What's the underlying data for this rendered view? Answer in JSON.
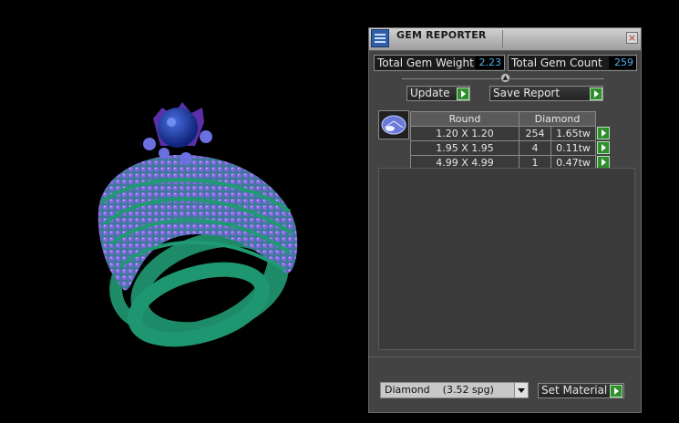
{
  "window": {
    "title": "GEM REPORTER",
    "close_glyph": "×"
  },
  "stats": {
    "weight_label": "Total Gem Weight",
    "weight_value": "2.23",
    "count_label": "Total Gem Count",
    "count_value": "259"
  },
  "toolbar": {
    "update_label": "Update",
    "save_label": "Save Report"
  },
  "table": {
    "headers": [
      "Round",
      "Diamond"
    ],
    "rows": [
      {
        "size": "1.20 X 1.20",
        "count": "254",
        "weight": "1.65tw"
      },
      {
        "size": "1.95 X 1.95",
        "count": "4",
        "weight": "0.11tw"
      },
      {
        "size": "4.99 X 4.99",
        "count": "1",
        "weight": "0.47tw"
      }
    ]
  },
  "material": {
    "selected": "Diamond    (3.52 spg)",
    "set_label": "Set Material"
  },
  "icons": {
    "app": "gem-reporter-icon",
    "close": "close-icon",
    "go": "green-arrow-icon",
    "collapse": "collapse-icon",
    "dropdown": "chevron-down-icon",
    "gem": "round-gem-icon"
  },
  "colors": {
    "panel": "#434343",
    "value_text": "#4fb0e8",
    "ring_metal": "#1f8a6a",
    "pave_stones": "#7a55d8",
    "center_stone": "#1e3fae"
  }
}
